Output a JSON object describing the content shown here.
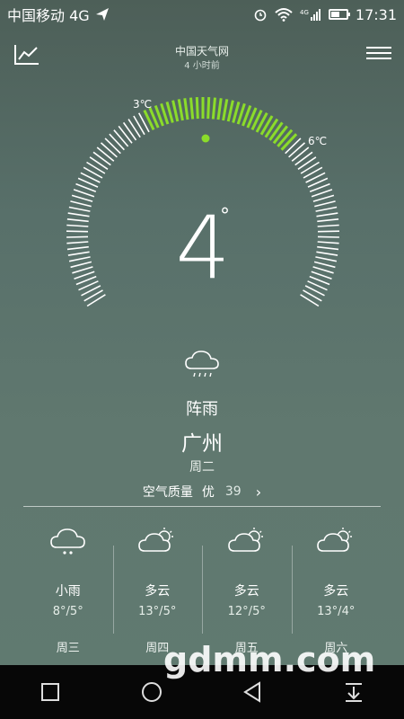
{
  "status_bar": {
    "carrier": "中国移动 4G",
    "net_type": "4G",
    "time": "17:31",
    "battery_level": 0.6,
    "icons": [
      "send-icon",
      "alarm-icon",
      "wifi-icon",
      "signal-icon",
      "battery-icon"
    ]
  },
  "header": {
    "source": "中国天气网",
    "updated": "4 小时前",
    "left_icon": "trend-chart-icon",
    "right_icon": "menu-icon"
  },
  "gauge": {
    "min_label": "3℃",
    "max_label": "6℃",
    "current_temp": "4",
    "degree_symbol": "°",
    "accent_color": "#8bdc2a",
    "tick_color": "#ffffff",
    "min_temp": 3,
    "max_temp": 6
  },
  "current": {
    "condition": "阵雨",
    "city": "广州",
    "weekday": "周二",
    "icon": "shower-rain-icon"
  },
  "air_quality": {
    "label": "空气质量",
    "level": "优",
    "value": "39"
  },
  "forecast": [
    {
      "condition": "小雨",
      "range": "8°/5°",
      "weekday": "周三",
      "icon": "light-rain-icon"
    },
    {
      "condition": "多云",
      "range": "13°/5°",
      "weekday": "周四",
      "icon": "partly-cloudy-icon"
    },
    {
      "condition": "多云",
      "range": "12°/5°",
      "weekday": "周五",
      "icon": "partly-cloudy-icon"
    },
    {
      "condition": "多云",
      "range": "13°/4°",
      "weekday": "周六",
      "icon": "partly-cloudy-icon"
    }
  ],
  "watermark": "gdmm.com",
  "navbar": {
    "icons": [
      "square-recents-icon",
      "circle-home-icon",
      "triangle-back-icon",
      "pull-down-notification-icon"
    ]
  }
}
